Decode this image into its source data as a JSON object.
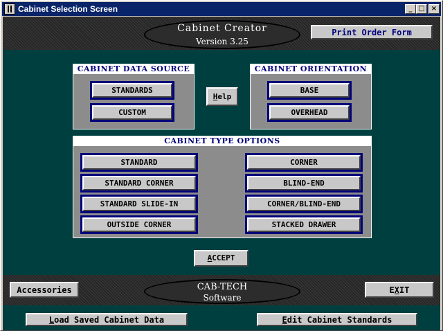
{
  "window": {
    "title": "Cabinet Selection Screen",
    "controls": {
      "minimize": "_",
      "maximize": "□",
      "close": "×"
    }
  },
  "header": {
    "app_name": "Cabinet Creator",
    "version": "Version 3.25",
    "print_button": "Print Order Form"
  },
  "data_source": {
    "label": "CABINET DATA SOURCE",
    "standards": "STANDARDS",
    "custom": "CUSTOM"
  },
  "help_button": {
    "mnemonic": "H",
    "rest": "elp"
  },
  "orientation": {
    "label": "CABINET ORIENTATION",
    "base": "BASE",
    "overhead": "OVERHEAD"
  },
  "type_options": {
    "label": "CABINET TYPE OPTIONS",
    "left": [
      "STANDARD",
      "STANDARD CORNER",
      "STANDARD SLIDE-IN",
      "OUTSIDE CORNER"
    ],
    "right": [
      "CORNER",
      "BLIND-END",
      "CORNER/BLIND-END",
      "STACKED DRAWER"
    ]
  },
  "accept_button": {
    "mnemonic": "A",
    "rest": "CCEPT"
  },
  "footer": {
    "accessories": "Accessories",
    "company": "CAB-TECH",
    "company_sub": "Software",
    "exit": {
      "pre": "E",
      "mnemonic": "X",
      "rest": "IT"
    }
  },
  "bottom": {
    "load_saved": {
      "mnemonic": "L",
      "rest": "oad Saved Cabinet Data"
    },
    "edit_standards": {
      "mnemonic": "E",
      "rest": "dit Cabinet Standards"
    }
  },
  "colors": {
    "title_bar": "#0a246a",
    "teal_background": "#003f3f",
    "group_label_text": "#00007a",
    "button_face": "#c8c8c8"
  }
}
